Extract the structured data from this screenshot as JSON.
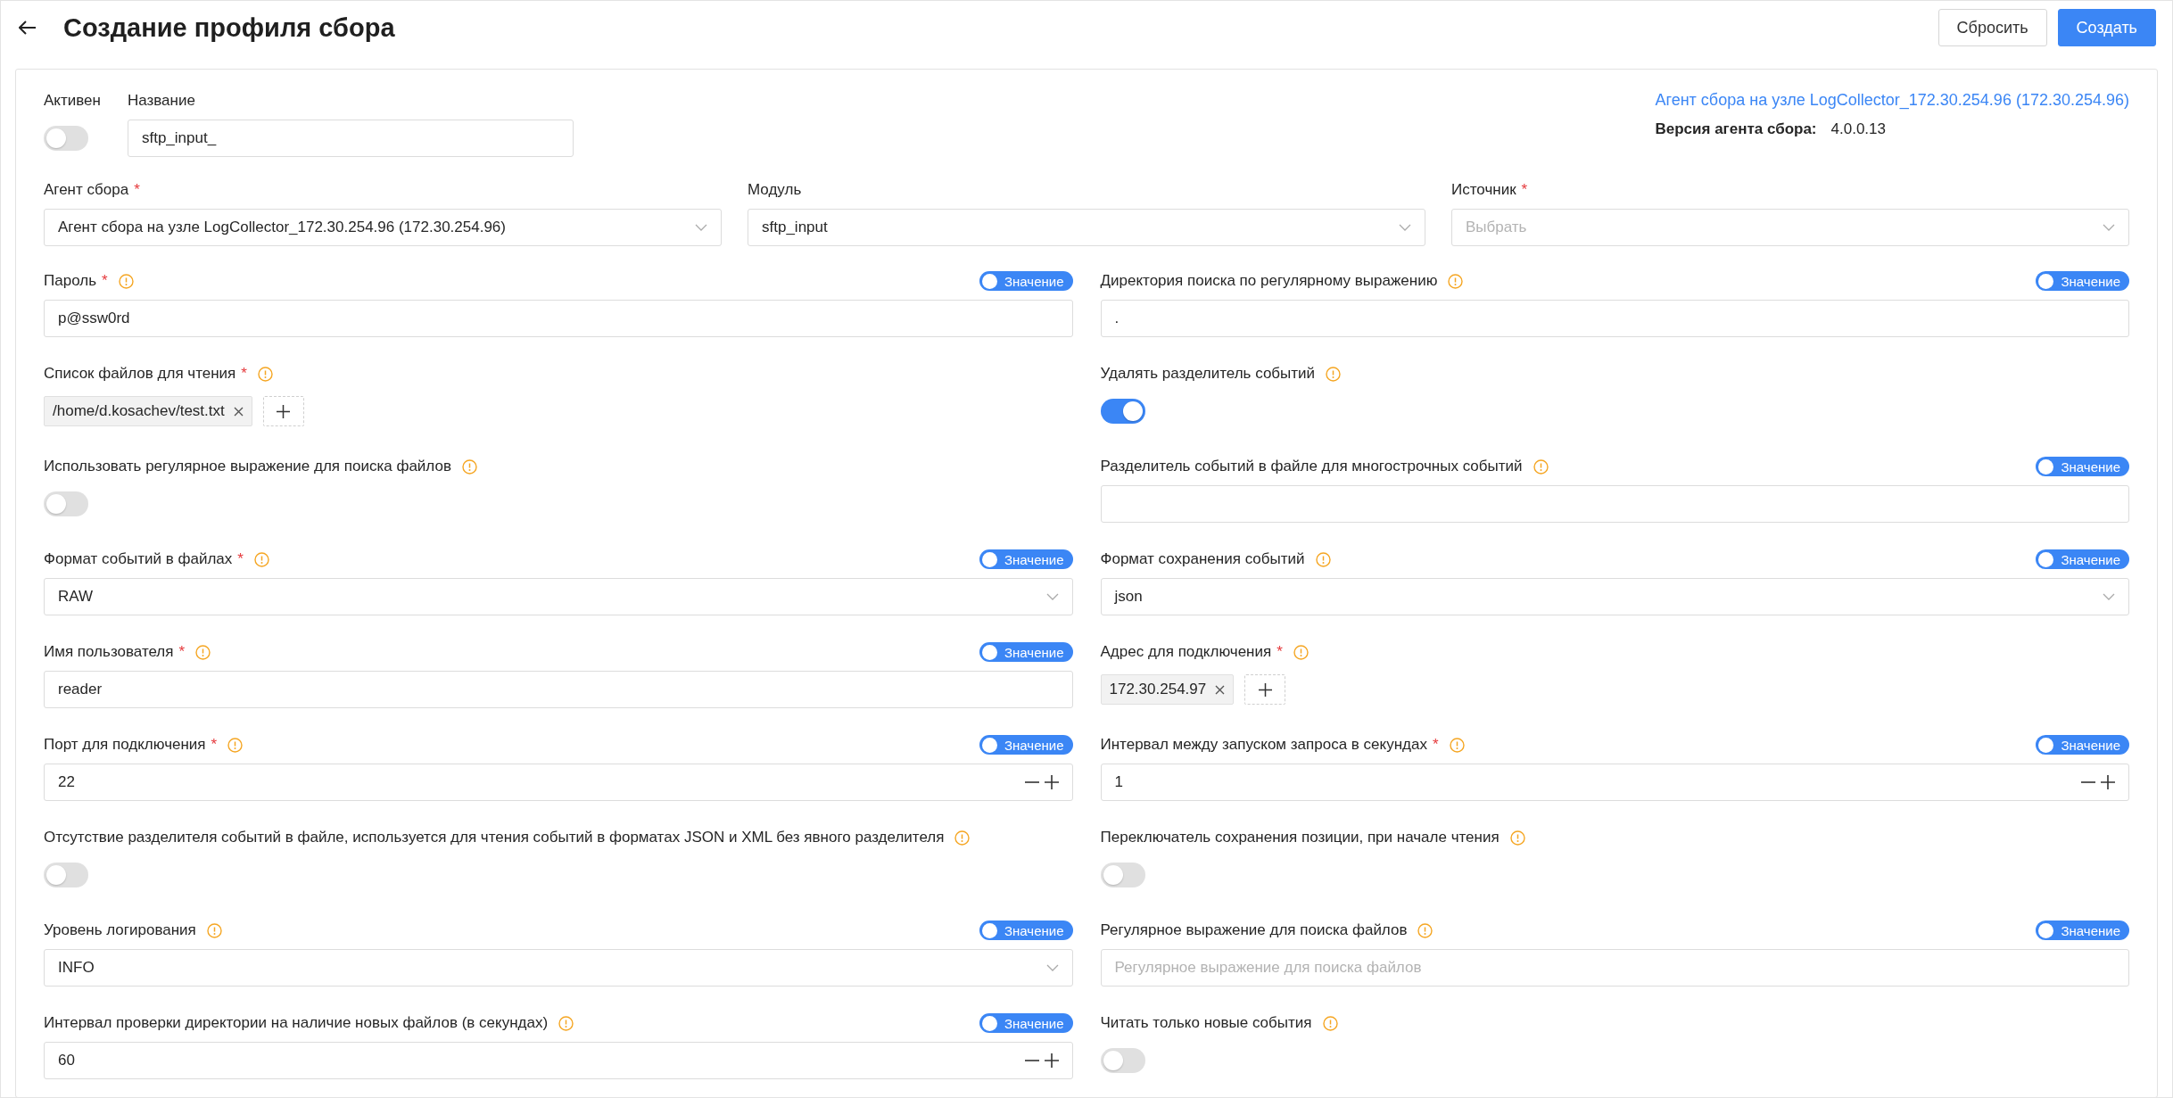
{
  "header": {
    "title": "Создание профиля сбора",
    "buttons": [
      {
        "label": "Сбросить",
        "kind": "secondary"
      },
      {
        "label": "Создать",
        "kind": "primary"
      }
    ]
  },
  "general": {
    "active": {
      "label": "Активен",
      "on": false
    },
    "name": {
      "label": "Название",
      "value": "sftp_input_"
    },
    "agent_link": "Агент сбора на узле LogCollector_172.30.254.96 (172.30.254.96)",
    "agent_version": {
      "label": "Версия агента сбора:",
      "value": "4.0.0.13"
    }
  },
  "selectors": [
    {
      "label": "Агент сбора",
      "required_mark": "*",
      "value": "Агент сбора на узле LogCollector_172.30.254.96 (172.30.254.96)"
    },
    {
      "label": "Модуль",
      "value": "sftp_input"
    },
    {
      "label": "Источник",
      "required_mark": "*",
      "placeholder": "Выбрать"
    }
  ],
  "fields": [
    {
      "kind": "text",
      "label": "Пароль",
      "required_mark": "*",
      "value_switch": {
        "label": "Значение",
        "on": true
      },
      "value": "p@ssw0rd"
    },
    {
      "kind": "text",
      "label": "Директория поиска по регулярному выражению",
      "value_switch": {
        "label": "Значение",
        "on": true
      },
      "value": "."
    },
    {
      "kind": "tags",
      "label": "Список файлов для чтения",
      "required_mark": "*",
      "tags": [
        "/home/d.kosachev/test.txt"
      ]
    },
    {
      "kind": "toggle",
      "label": "Удалять разделитель событий",
      "on": true
    },
    {
      "kind": "toggle",
      "label": "Использовать регулярное выражение для поиска файлов",
      "on": false
    },
    {
      "kind": "text",
      "label": "Разделитель событий в файле для многострочных событий",
      "value_switch": {
        "label": "Значение",
        "on": true
      }
    },
    {
      "kind": "select",
      "label": "Формат событий в файлах",
      "required_mark": "*",
      "value_switch": {
        "label": "Значение",
        "on": true
      },
      "value": "RAW"
    },
    {
      "kind": "select",
      "label": "Формат сохранения событий",
      "value_switch": {
        "label": "Значение",
        "on": true
      },
      "value": "json"
    },
    {
      "kind": "text",
      "label": "Имя пользователя",
      "required_mark": "*",
      "value_switch": {
        "label": "Значение",
        "on": true
      },
      "value": "reader"
    },
    {
      "kind": "tags",
      "label": "Адрес для подключения",
      "required_mark": "*",
      "tags": [
        "172.30.254.97"
      ]
    },
    {
      "kind": "number",
      "label": "Порт для подключения",
      "required_mark": "*",
      "value_switch": {
        "label": "Значение",
        "on": true
      },
      "value": "22"
    },
    {
      "kind": "number",
      "label": "Интервал между запуском запроса в секундах",
      "required_mark": "*",
      "value_switch": {
        "label": "Значение",
        "on": true
      },
      "value": "1"
    },
    {
      "kind": "toggle",
      "label": "Отсутствие разделителя событий в файле, используется для чтения событий в форматах JSON и XML без явного разделителя",
      "on": false
    },
    {
      "kind": "toggle",
      "label": "Переключатель сохранения позиции, при начале чтения",
      "on": false
    },
    {
      "kind": "select",
      "label": "Уровень логирования",
      "value_switch": {
        "label": "Значение",
        "on": true
      },
      "value": "INFO"
    },
    {
      "kind": "text",
      "label": "Регулярное выражение для поиска файлов",
      "value_switch": {
        "label": "Значение",
        "on": true
      },
      "placeholder": "Регулярное выражение для поиска файлов"
    },
    {
      "kind": "number",
      "label": "Интервал проверки директории на наличие новых файлов (в секундах)",
      "value_switch": {
        "label": "Значение",
        "on": true
      },
      "value": "60"
    },
    {
      "kind": "toggle",
      "label": "Читать только новые события",
      "on": false
    }
  ]
}
